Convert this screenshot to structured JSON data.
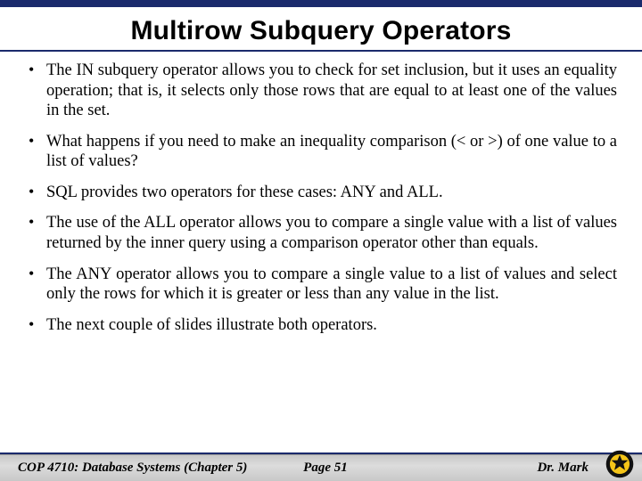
{
  "slide": {
    "title": "Multirow Subquery Operators",
    "bullets": [
      "The IN subquery operator allows you to check for set inclusion, but it uses an equality operation; that is, it selects only those rows that are equal to at least one of the values in the set.",
      "What happens if you need to make an inequality comparison (< or >) of one value to a list of values?",
      "SQL provides two operators for these cases: ANY and ALL.",
      "The use of the ALL operator allows you to compare a single value with a list of values returned by the inner query using a comparison operator other than equals.",
      "The ANY operator allows you to compare a single value to a list of values and select only the rows for which it is greater or less than any value in the list.",
      "The next couple of slides illustrate both operators."
    ]
  },
  "footer": {
    "course": "COP 4710: Database Systems  (Chapter 5)",
    "page": "Page 51",
    "author": "Dr. Mark"
  }
}
